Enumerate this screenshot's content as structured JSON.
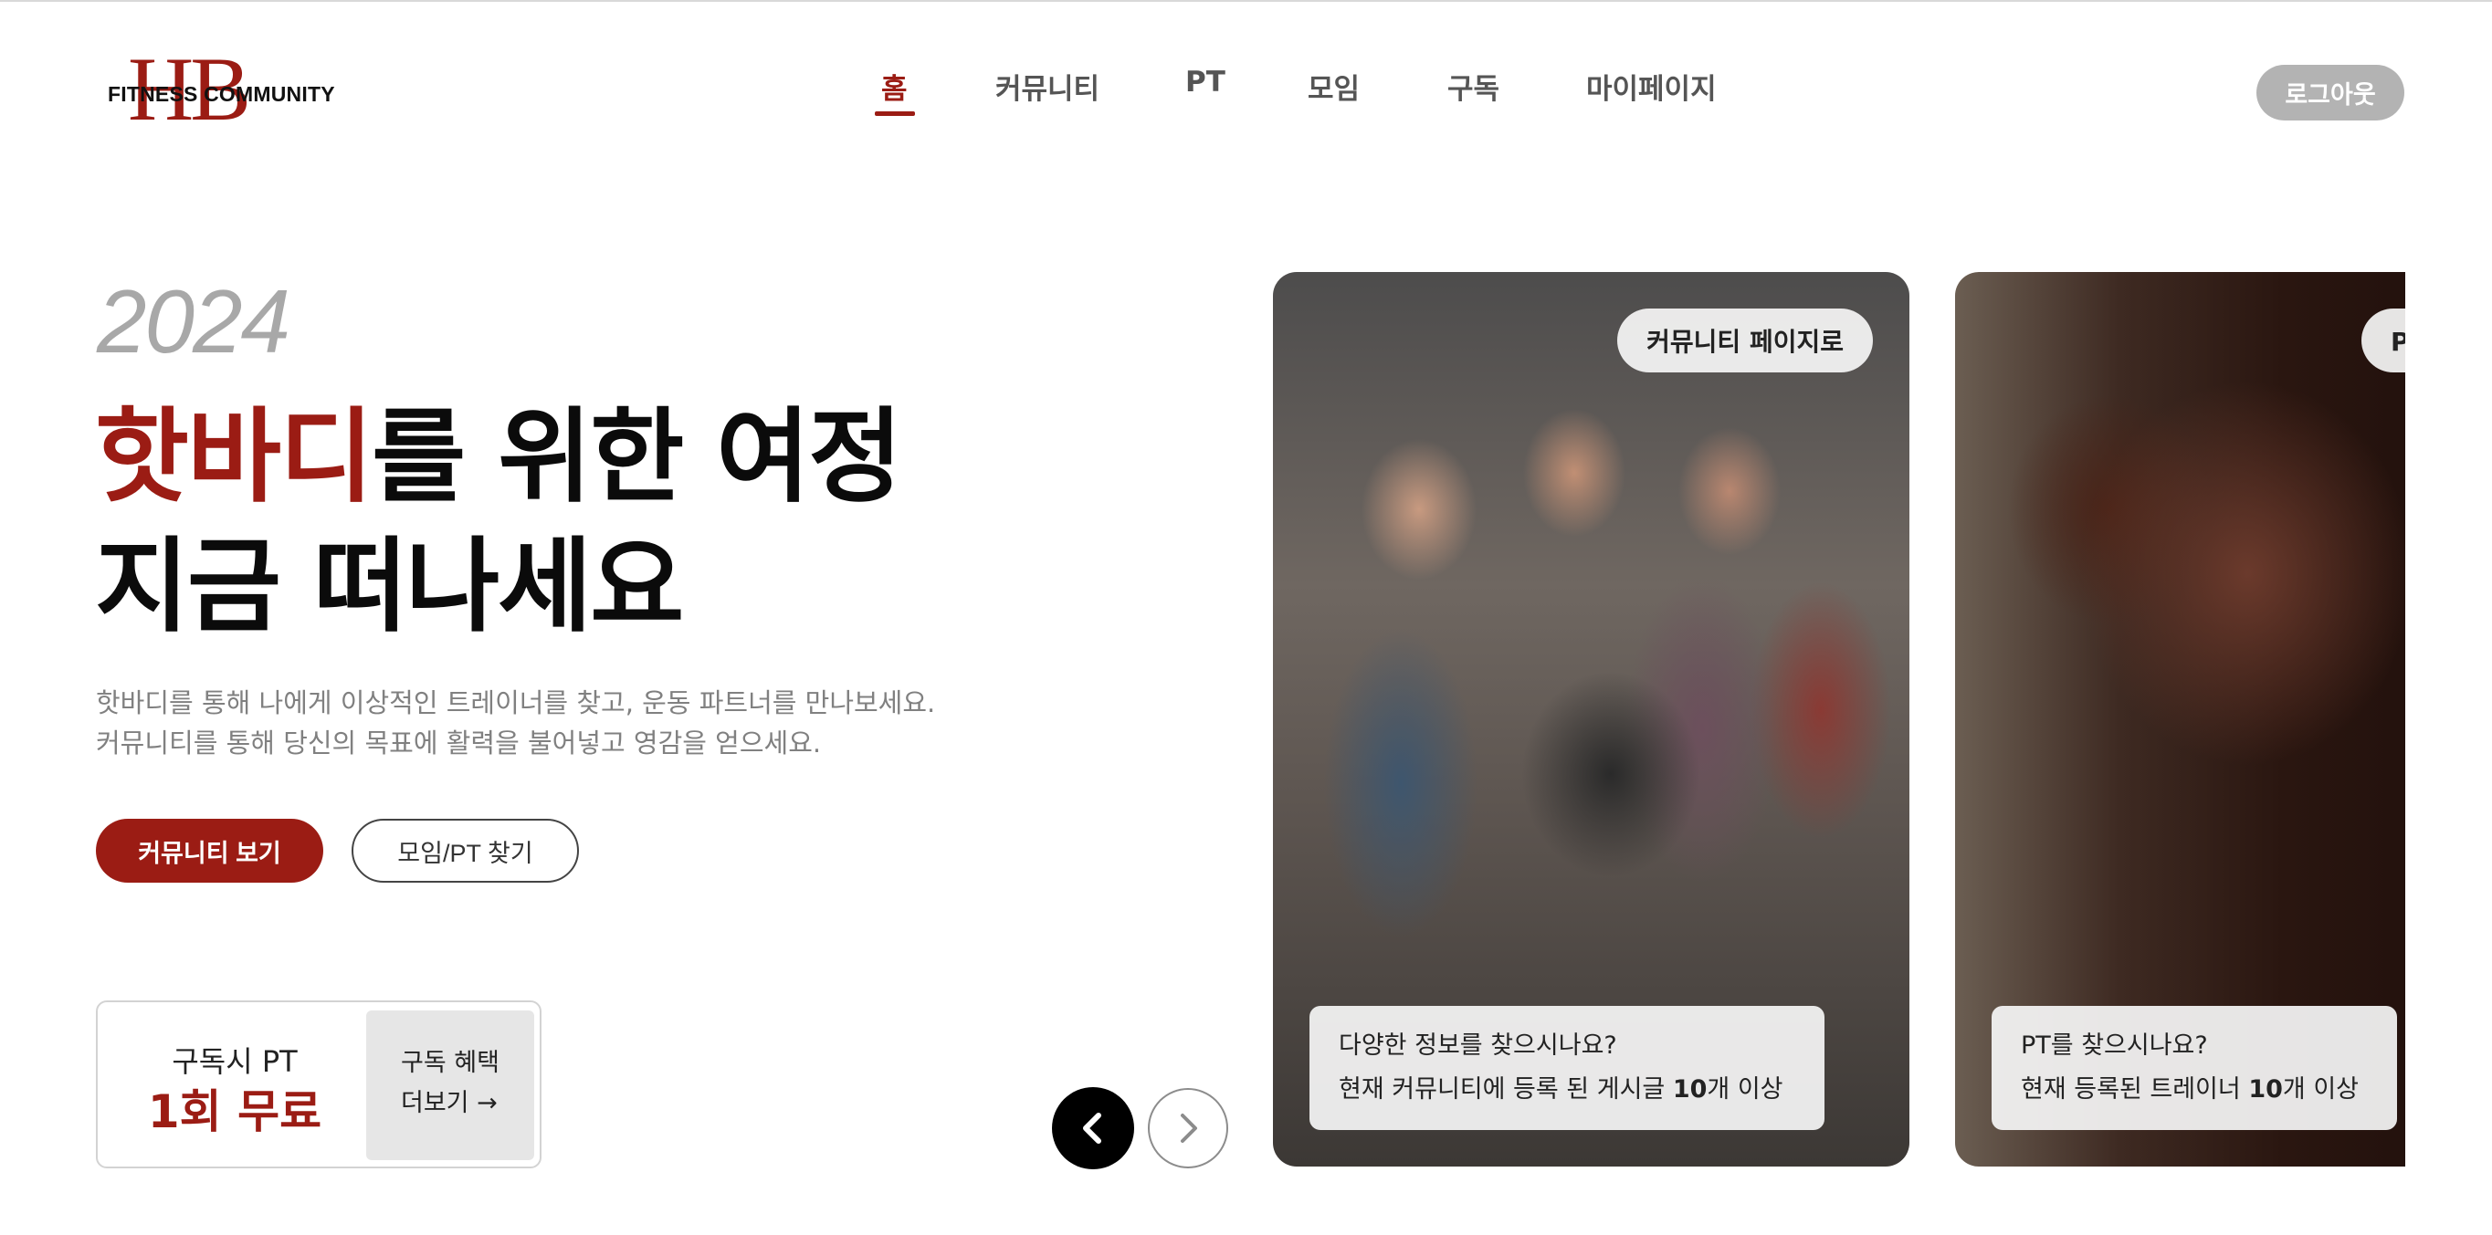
{
  "header": {
    "logo": {
      "monogram": "HB",
      "text": "FITNESS COMMUNITY"
    },
    "nav": [
      {
        "label": "홈",
        "active": true
      },
      {
        "label": "커뮤니티",
        "active": false
      },
      {
        "label": "PT",
        "active": false
      },
      {
        "label": "모임",
        "active": false
      },
      {
        "label": "구독",
        "active": false
      },
      {
        "label": "마이페이지",
        "active": false
      }
    ],
    "logout_label": "로그아웃"
  },
  "hero": {
    "year": "2024",
    "headline_accent": "핫바디",
    "headline_rest": "를 위한 여정",
    "headline_line2": "지금 떠나세요",
    "description_line1": "핫바디를 통해 나에게 이상적인 트레이너를 찾고, 운동 파트너를 만나보세요.",
    "description_line2": "커뮤니티를 통해 당신의 목표에 활력을 불어넣고 영감을 얻으세요.",
    "primary_button": "커뮤니티 보기",
    "secondary_button": "모임/PT 찾기",
    "promo": {
      "small": "구독시 PT",
      "big": "1회 무료",
      "link_line1": "구독 혜택",
      "link_line2": "더보기 →"
    }
  },
  "carousel": {
    "prev_icon": "chevron-left-icon",
    "next_icon": "chevron-right-icon",
    "cards": [
      {
        "tag": "커뮤니티 페이지로",
        "info_line1": "다양한 정보를 찾으시나요?",
        "info_line2_prefix": "현재 커뮤니티에 등록 된 게시글 ",
        "info_line2_number": "10",
        "info_line2_suffix": "개 이상"
      },
      {
        "tag": "PT 페이지로",
        "info_line1": "PT를 찾으시나요?",
        "info_line2_prefix": "현재 등록된 트레이너 ",
        "info_line2_number": "10",
        "info_line2_suffix": "개 이상"
      }
    ]
  },
  "colors": {
    "accent": "#9b1c14",
    "logout_bg": "#b3b3b3",
    "muted_text": "#808080"
  }
}
